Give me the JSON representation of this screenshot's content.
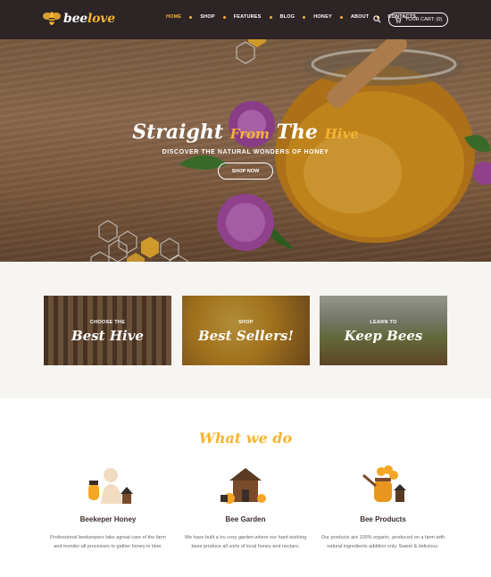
{
  "brand": {
    "name_part1": "bee",
    "name_part2": "love"
  },
  "nav": {
    "items": [
      {
        "label": "HOME",
        "active": true
      },
      {
        "label": "SHOP",
        "active": false
      },
      {
        "label": "FEATURES",
        "active": false
      },
      {
        "label": "BLOG",
        "active": false
      },
      {
        "label": "HONEY",
        "active": false
      },
      {
        "label": "ABOUT",
        "active": false
      },
      {
        "label": "CONTACTS",
        "active": false
      }
    ],
    "cart_label": "YOUR CART: (0)"
  },
  "hero": {
    "title_w1": "Straight",
    "title_w2": "From",
    "title_w3": "The",
    "title_w4": "Hive",
    "subtitle": "DISCOVER THE NATURAL WONDERS OF HONEY",
    "button": "SHOP NOW"
  },
  "categories": [
    {
      "small": "CHOOSE THE",
      "big": "Best Hive"
    },
    {
      "small": "SHOP",
      "big": "Best Sellers!"
    },
    {
      "small": "LEARN TO",
      "big": "Keep Bees"
    }
  ],
  "what_we_do": {
    "title": "What we do",
    "features": [
      {
        "title": "Beekeper Honey",
        "description": "Professional beekeepers take agreat care of the farm and monitor all processes to gather honey in time.",
        "icon": "beekeeper-icon"
      },
      {
        "title": "Bee Garden",
        "description": "We have built a tru cosy garden where our hard working bees produce all sorts of local honey and nectars.",
        "icon": "bee-house-icon"
      },
      {
        "title": "Bee Products",
        "description": "Our products are 100% organic, produced on a farm with natural ingredients addition only. Sweet & delicious.",
        "icon": "honey-products-icon"
      }
    ]
  },
  "colors": {
    "accent": "#f5b532",
    "header_bg": "#2d2426",
    "text_dark": "#3a2e2a",
    "section_bg": "#f7f5f2"
  }
}
